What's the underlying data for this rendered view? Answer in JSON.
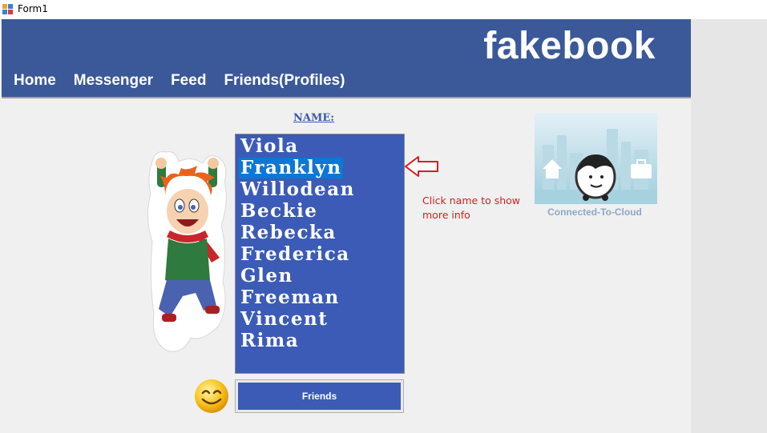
{
  "window": {
    "title": "Form1",
    "icon": "winforms-app-icon"
  },
  "header": {
    "logo": "fakebook",
    "nav": [
      "Home",
      "Messenger",
      "Feed",
      "Friends(Profiles)"
    ],
    "background": "#3b5998"
  },
  "name_label": "NAME:",
  "friends_list": {
    "items": [
      "Viola",
      "Franklyn",
      "Willodean",
      "Beckie",
      "Rebecka",
      "Frederica",
      "Glen",
      "Freeman",
      "Vincent",
      "Rima"
    ],
    "selected_index": 1,
    "background": "#3b5bb7",
    "selection_color": "#0a78d7"
  },
  "hint_text": "Click name to show more info",
  "hint_color": "#d81e1e",
  "status": {
    "label": "Connected-To-Cloud"
  },
  "friends_button": {
    "label": "Friends"
  },
  "icons": {
    "character": "jumping-cartoon-boy-icon",
    "arrow": "left-arrow-icon",
    "cloud": "connected-to-cloud-icon",
    "smiley": "smiley-face-icon"
  }
}
